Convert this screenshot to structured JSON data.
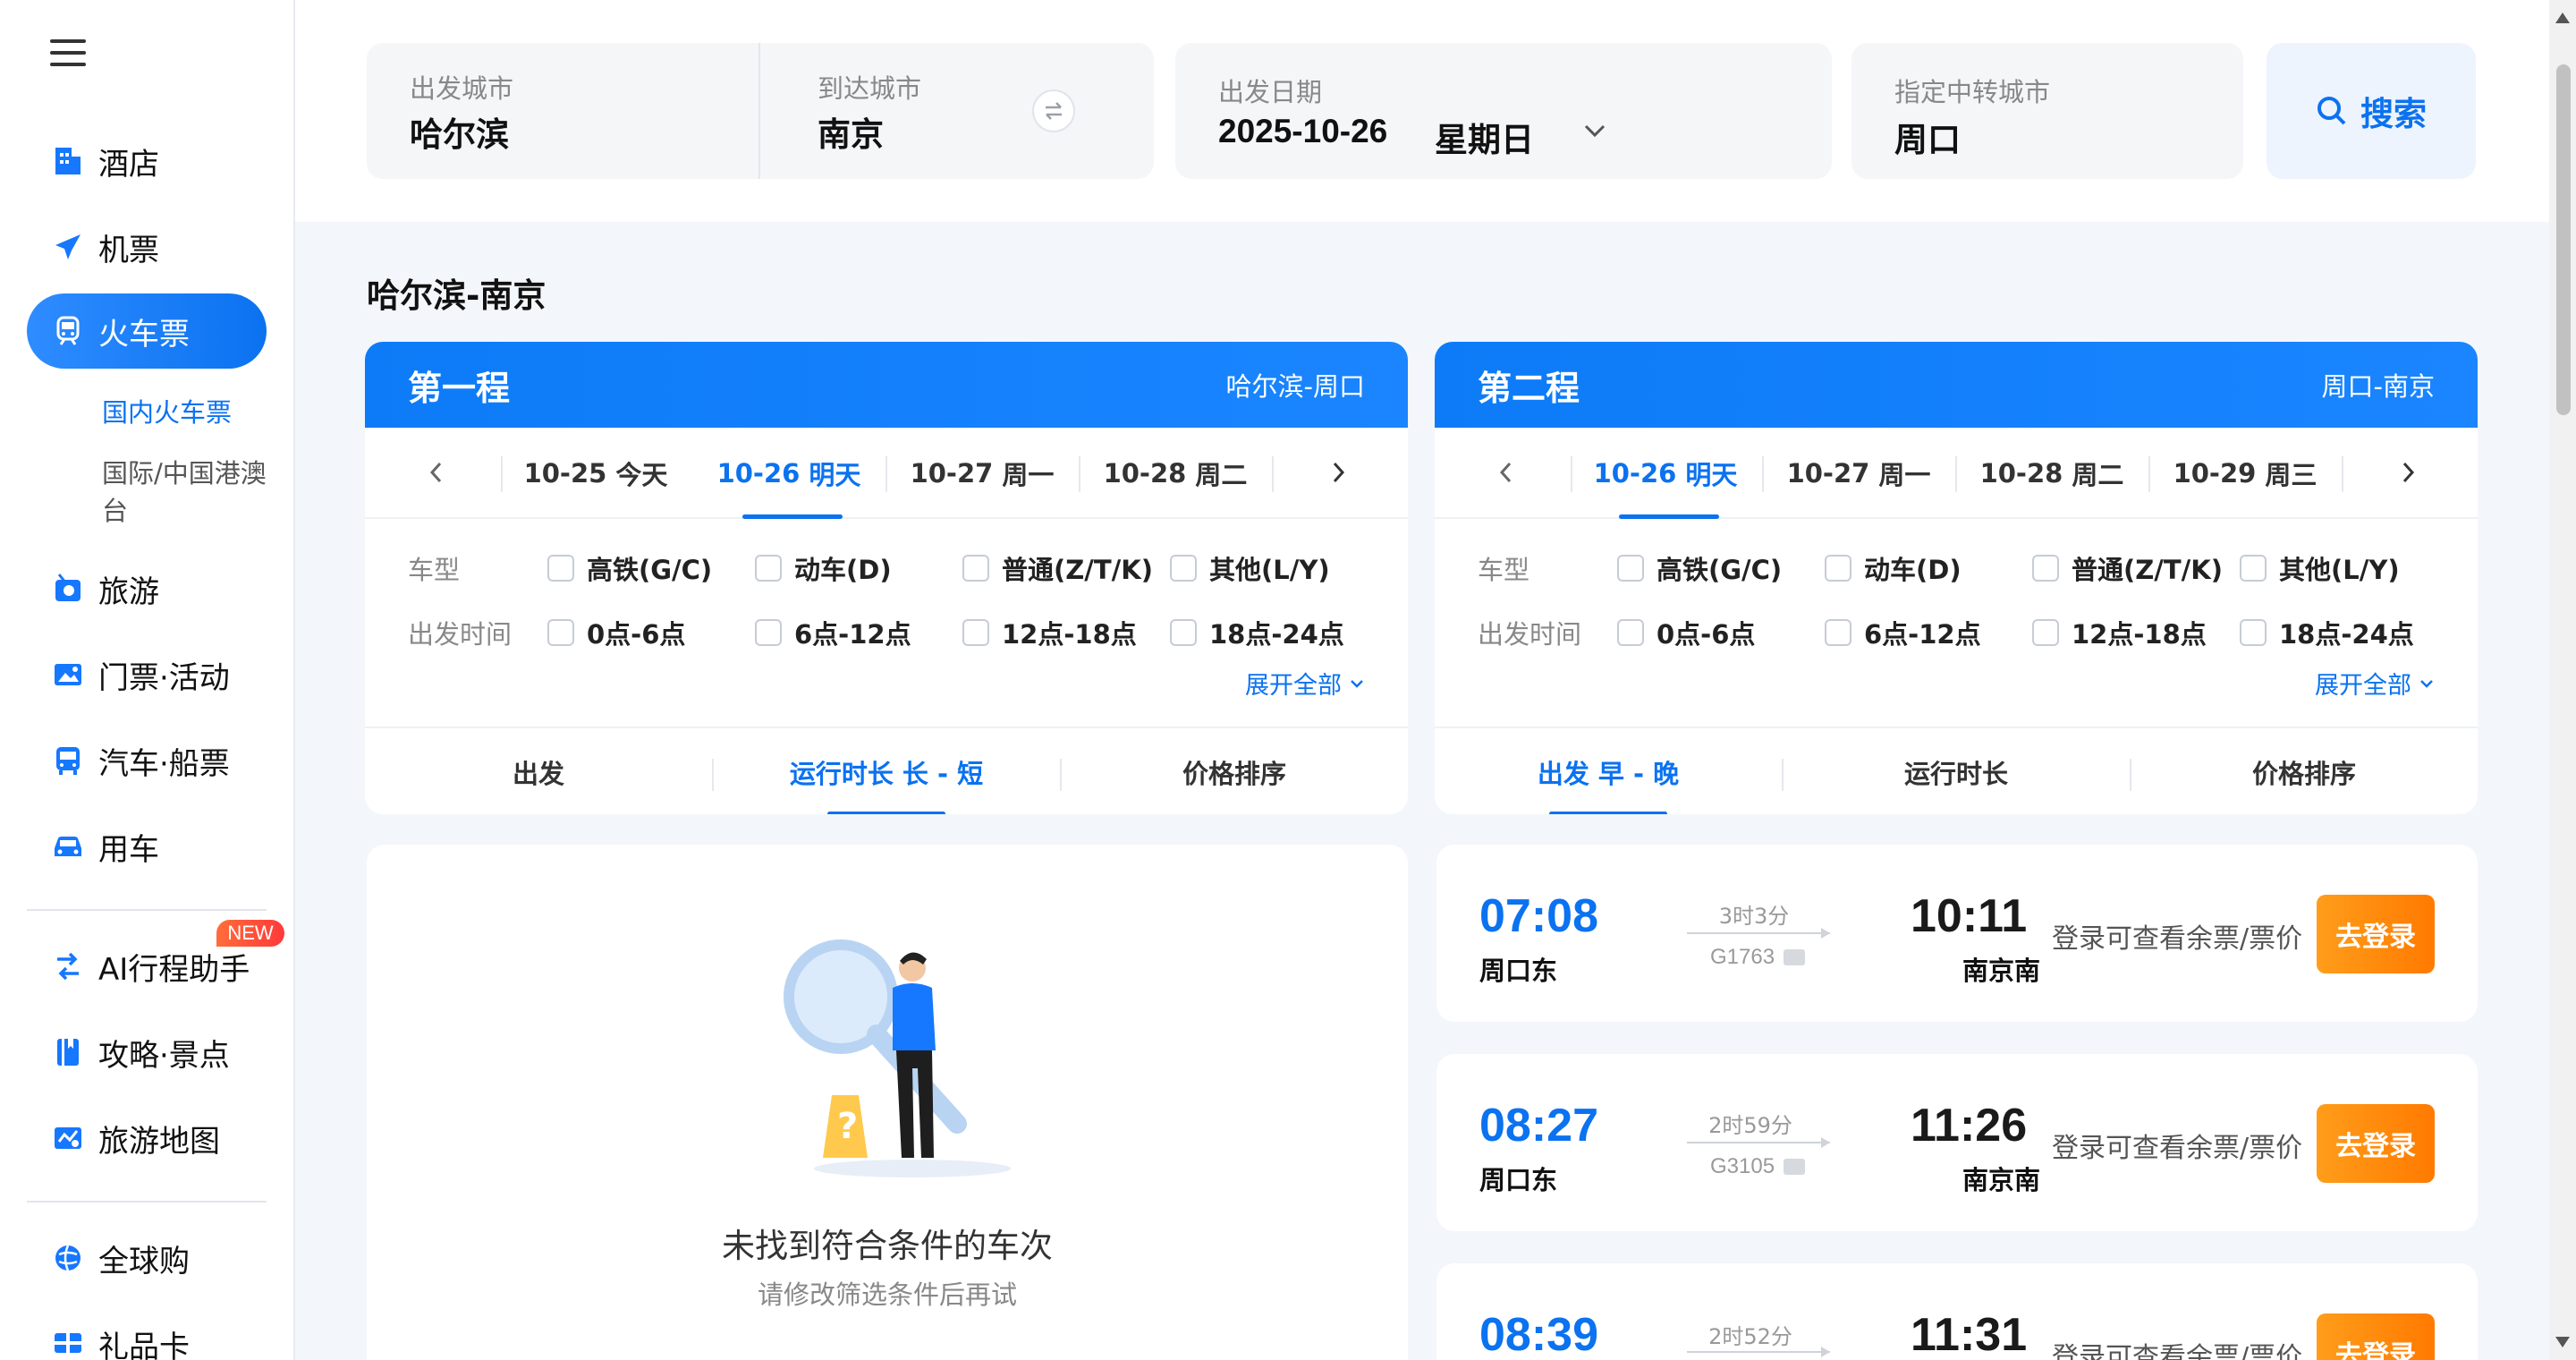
{
  "sidebar": {
    "nav": [
      {
        "label": "酒店",
        "icon": "hotel-icon"
      },
      {
        "label": "机票",
        "icon": "plane-icon"
      },
      {
        "label": "火车票",
        "icon": "train-icon"
      },
      {
        "label": "旅游",
        "icon": "travel-icon"
      },
      {
        "label": "门票·活动",
        "icon": "ticket-icon"
      },
      {
        "label": "汽车·船票",
        "icon": "bus-icon"
      },
      {
        "label": "用车",
        "icon": "car-icon"
      },
      {
        "label": "AI行程助手",
        "icon": "ai-assistant-icon"
      },
      {
        "label": "攻略·景点",
        "icon": "guide-book-icon"
      },
      {
        "label": "旅游地图",
        "icon": "map-icon"
      },
      {
        "label": "全球购",
        "icon": "global-shop-icon"
      },
      {
        "label": "礼品卡",
        "icon": "gift-card-icon"
      }
    ],
    "sub": [
      "国内火车票",
      "国际/中国港澳台"
    ],
    "new_badge": "NEW"
  },
  "search": {
    "from_label": "出发城市",
    "from_value": "哈尔滨",
    "to_label": "到达城市",
    "to_value": "南京",
    "date_label": "出发日期",
    "date_value": "2025-10-26",
    "weekday": "星期日",
    "transfer_label": "指定中转城市",
    "transfer_value": "周口",
    "button": "搜索"
  },
  "route_title": "哈尔滨-南京",
  "legs": [
    {
      "title": "第一程",
      "route": "哈尔滨-周口",
      "dates": [
        {
          "date": "10-25",
          "day": "今天"
        },
        {
          "date": "10-26",
          "day": "明天"
        },
        {
          "date": "10-27",
          "day": "周一"
        },
        {
          "date": "10-28",
          "day": "周二"
        }
      ],
      "active_date": 1,
      "sorts": [
        "出发",
        "运行时长  长 - 短",
        "价格排序"
      ],
      "active_sort": 1
    },
    {
      "title": "第二程",
      "route": "周口-南京",
      "dates": [
        {
          "date": "10-26",
          "day": "明天"
        },
        {
          "date": "10-27",
          "day": "周一"
        },
        {
          "date": "10-28",
          "day": "周二"
        },
        {
          "date": "10-29",
          "day": "周三"
        }
      ],
      "active_date": 0,
      "sorts": [
        "出发  早 - 晚",
        "运行时长",
        "价格排序"
      ],
      "active_sort": 0
    }
  ],
  "filters": {
    "type_label": "车型",
    "types": [
      "高铁(G/C)",
      "动车(D)",
      "普通(Z/T/K)",
      "其他(L/Y)"
    ],
    "time_label": "出发时间",
    "times": [
      "0点-6点",
      "6点-12点",
      "12点-18点",
      "18点-24点"
    ],
    "expand": "展开全部"
  },
  "empty": {
    "title": "未找到符合条件的车次",
    "subtitle": "请修改筛选条件后再试"
  },
  "trains": [
    {
      "dep_time": "07:08",
      "dep_station": "周口东",
      "duration": "3时3分",
      "train_no": "G1763",
      "arr_time": "10:11",
      "arr_station": "南京南",
      "info": "登录可查看余票/票价",
      "button": "去登录"
    },
    {
      "dep_time": "08:27",
      "dep_station": "周口东",
      "duration": "2时59分",
      "train_no": "G3105",
      "arr_time": "11:26",
      "arr_station": "南京南",
      "info": "登录可查看余票/票价",
      "button": "去登录"
    },
    {
      "dep_time": "08:39",
      "dep_station": "",
      "duration": "2时52分",
      "train_no": "",
      "arr_time": "11:31",
      "arr_station": "",
      "info": "登录可查看余票/票价",
      "button": "去登录"
    }
  ],
  "colors": {
    "accent": "#0b72f0",
    "login_button": "#ff8a00",
    "badge": "#ff4d3a"
  }
}
